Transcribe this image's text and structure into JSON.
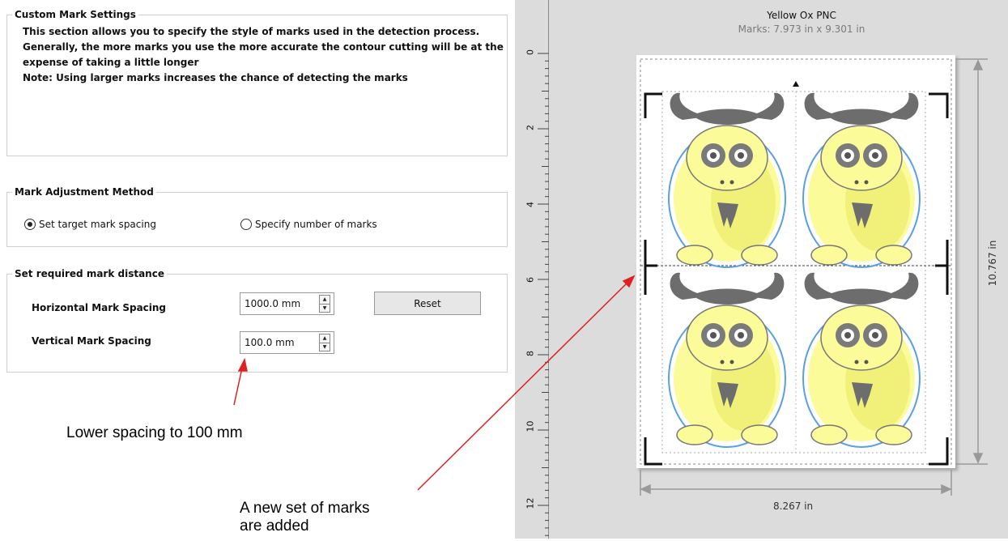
{
  "custom_mark_settings": {
    "title": "Custom Mark Settings",
    "description_lines": [
      "This section allows you to specify the style of marks used in the detection process.",
      "Generally, the more marks you use the more accurate the contour cutting will be at the",
      "expense of taking a little longer",
      "Note: Using larger marks increases the chance of detecting the marks"
    ]
  },
  "mark_adjustment": {
    "title": "Mark Adjustment Method",
    "options": [
      {
        "label": "Set target mark spacing",
        "selected": true
      },
      {
        "label": "Specify number of marks",
        "selected": false
      }
    ]
  },
  "mark_distance": {
    "title": "Set required mark distance",
    "horizontal_label": "Horizontal Mark Spacing",
    "horizontal_value": "1000.0 mm",
    "vertical_label": "Vertical Mark Spacing",
    "vertical_value": "100.0 mm",
    "reset_label": "Reset"
  },
  "callouts": {
    "lower_spacing": "Lower spacing to 100 mm",
    "new_marks_line1": "A new set of marks",
    "new_marks_line2": "are added"
  },
  "preview": {
    "title": "Yellow Ox PNC",
    "marks_size": "Marks: 7.973 in x 9.301 in",
    "width_label": "8.267 in",
    "height_label": "10.767 in",
    "ruler_ticks": [
      "0",
      "2",
      "4",
      "6",
      "8",
      "10",
      "12"
    ]
  },
  "colors": {
    "arrow": "#e02020",
    "ox_body": "#fbfb9a",
    "ox_horn": "#707070",
    "ox_outline": "#5aa0e0"
  }
}
